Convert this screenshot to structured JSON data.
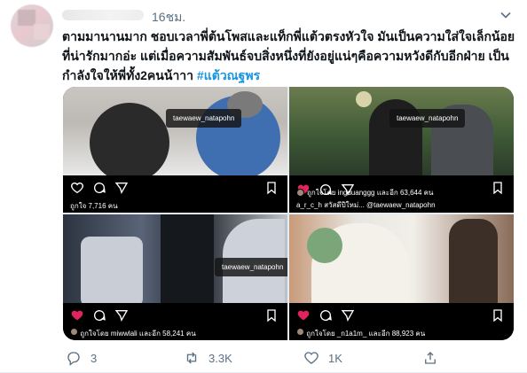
{
  "tweet": {
    "time": "16ชม.",
    "text_lines": [
      "ตามมานานมาก ชอบเวลาพี่ต้นโพสและแท็กพี่แต้วตรงหัวใจ มันเป็นความใส่ใจเล็กน้อย",
      "ที่น่ารักมากอ่ะ แต่เมื่อความสัมพันธ์จบสิ่งหนึ่งที่ยังอยู่แน่ๆคือความหวังดีกับอีกฝ่าย เป็น",
      "กำลังใจให้พี่ทั้ง2คนน้าาา "
    ],
    "hashtag": "#แต้วณฐพร",
    "reply_count": "3",
    "retweet_count": "3.3K",
    "like_count": "1K"
  },
  "photos": [
    {
      "tag": "taewaew_natapohn",
      "likes": "ถูกใจ 7,716 คน",
      "liked": false
    },
    {
      "tag": "taewaew_natapohn",
      "likes": "ถูกใจโดย ingduanggg และอีก 63,644 คน",
      "comment": "a_r_c_h สวัสดีปีใหม่... @taewaew_natapohn",
      "liked": true
    },
    {
      "tag": "taewaew_natapohn",
      "likes": "ถูกใจโดย miwwlali และอีก 58,241 คน",
      "liked": true
    },
    {
      "tag": "",
      "likes": "ถูกใจโดย _n1a1m_ และอีก 88,923 คน",
      "liked": true
    }
  ],
  "colors": {
    "accent": "#1b95e0",
    "muted": "#5b7083",
    "heart": "#e0245e"
  },
  "icons": [
    "caret-down-icon",
    "reply-icon",
    "retweet-icon",
    "like-icon",
    "share-icon",
    "heart-icon",
    "comment-icon",
    "send-icon",
    "bookmark-icon",
    "person-tag-icon"
  ]
}
